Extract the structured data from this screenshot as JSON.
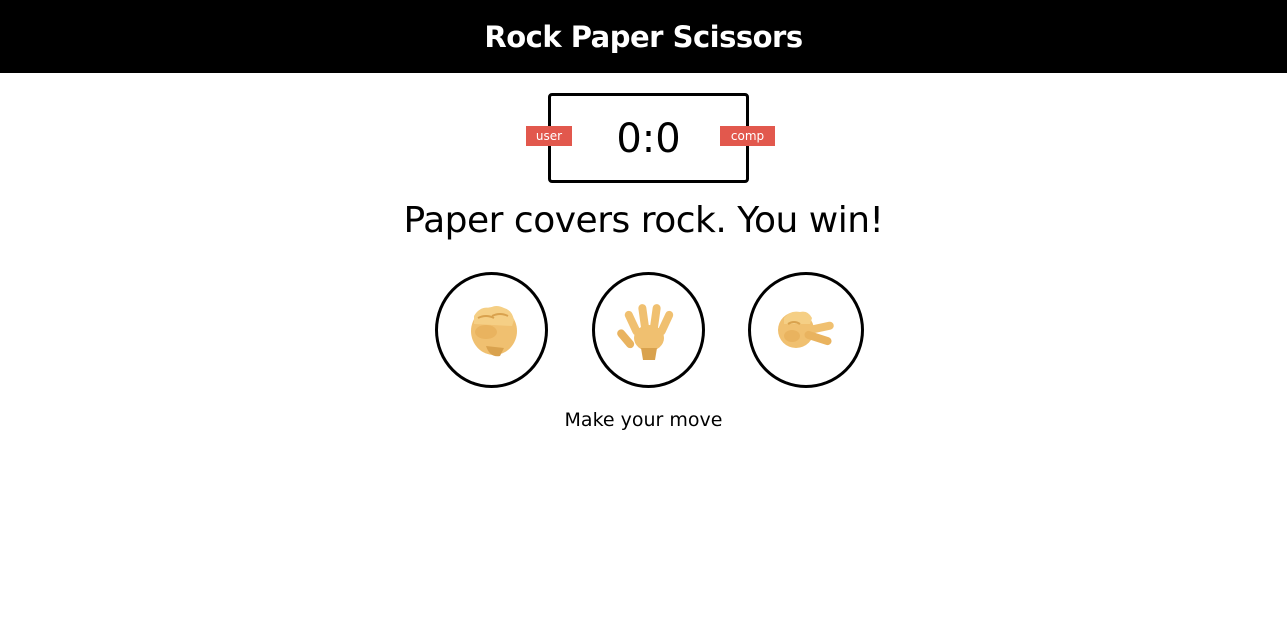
{
  "header": {
    "title": "Rock Paper Scissors"
  },
  "scoreboard": {
    "user_label": "user",
    "comp_label": "comp",
    "score": "0:0"
  },
  "result_message": "Paper covers rock. You win!",
  "choices": [
    {
      "name": "rock",
      "icon": "fist-icon"
    },
    {
      "name": "paper",
      "icon": "open-hand-icon"
    },
    {
      "name": "scissors",
      "icon": "scissors-hand-icon"
    }
  ],
  "action_prompt": "Make your move",
  "colors": {
    "header_bg": "#000000",
    "badge_bg": "#e2584d",
    "hand_fill": "#f0c070",
    "hand_shadow": "#d9a24e"
  }
}
